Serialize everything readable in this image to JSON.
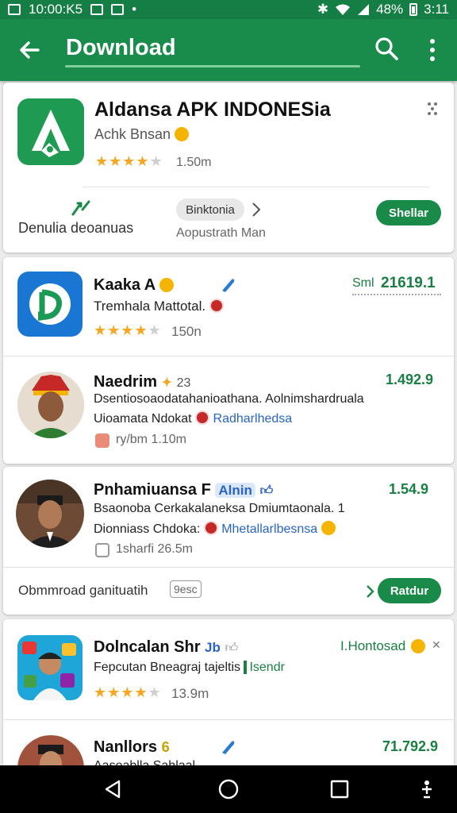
{
  "status_bar": {
    "left_text": "10:00:K5",
    "battery": "48%",
    "time_right": "3:11"
  },
  "header": {
    "title": "Download"
  },
  "featured": {
    "app_name": "Aldansa APK INDONESia",
    "developer": "Achk Bnsan",
    "rating_text": "1.50m",
    "category_label": "Denulia deoanuas",
    "chip_label": "Binktonia",
    "chip_subtitle": "Aopustrath Man",
    "action_button": "Shellar",
    "icon_letter": "A",
    "icon_color": "#1f9a52"
  },
  "list": [
    {
      "name": "Kaaka A",
      "subtitle": "Tremhala Mattotal.",
      "rating_text": "150n",
      "price_prefix": "Sml",
      "price": "21619.1",
      "icon_color": "#1976d2"
    },
    {
      "name": "Naedrim",
      "name_suffix": "23",
      "line1": "Dsentiosoaodatahanioathana. Aolnimshardruala",
      "line2_prefix": "Uioamata Ndokat",
      "line2_link": "Radharlhedsa",
      "meta": "ry/bm  1.10m",
      "price": "1.492.9"
    },
    {
      "name": "Pnhamiuansa F",
      "name_link": "Alnin",
      "line1": "Bsaonoba Cerkakalaneksa  Dmiumtaonala. 1",
      "line2_prefix": "Dionniass Chdoka:",
      "line2_link": "Mhetallarlbesnsa",
      "meta": "1sharfi  26.5m",
      "price": "1.54.9"
    }
  ],
  "promo_row": {
    "label": "Obmmroad ganituatih",
    "tag": "9esc",
    "button": "Ratdur"
  },
  "list2": [
    {
      "name": "Dolncalan Shr",
      "name_suffix": "Jb",
      "subtitle": "Fepcutan Bneagraj tajeltis",
      "subtitle_tag": "Isendr",
      "rating_text": "13.9m",
      "price": "I.Hontosad"
    },
    {
      "name": "Nanllors",
      "name_suffix": "6",
      "subtitle": "Aaseablla Sahlaal",
      "price": "71.792.9"
    }
  ]
}
